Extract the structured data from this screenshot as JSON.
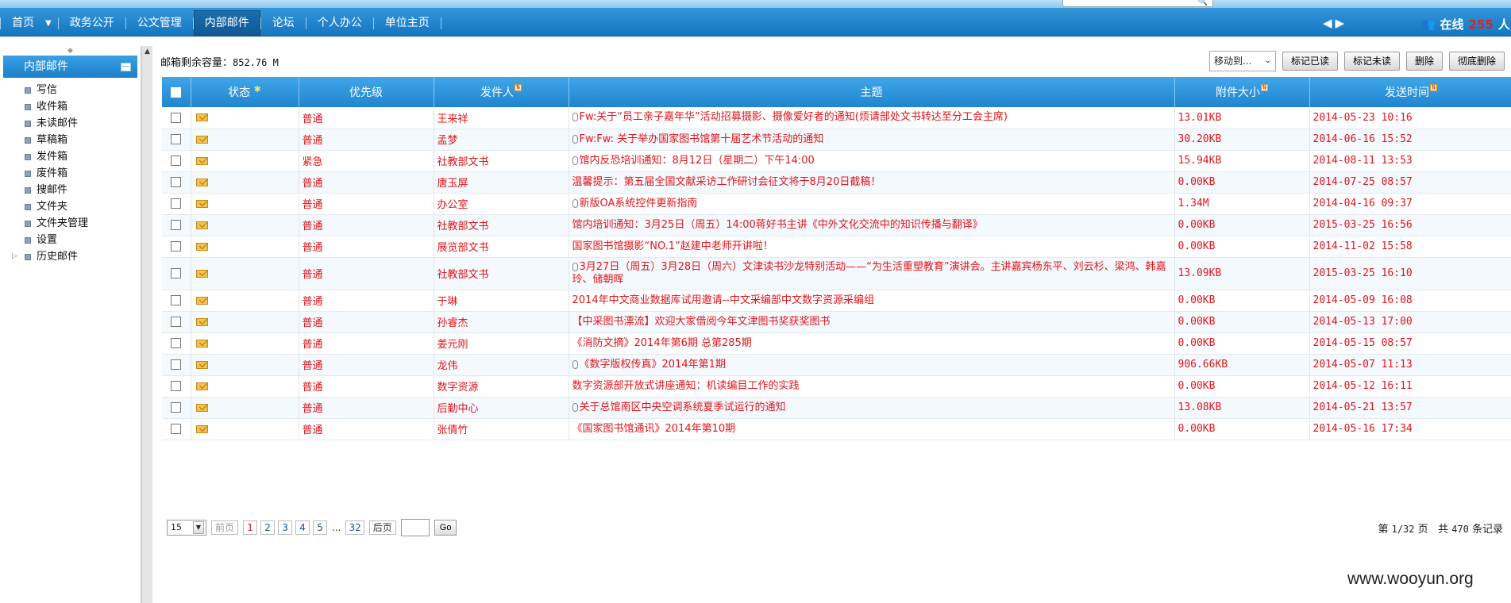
{
  "nav": {
    "items": [
      "首页",
      "政务公开",
      "公文管理",
      "内部邮件",
      "论坛",
      "个人办公",
      "单位主页"
    ],
    "active_index": 3,
    "search_icon": "magnifier-icon",
    "arrows_icon": "nav-arrows-icon"
  },
  "online": {
    "prefix": "在线",
    "count": "255",
    "suffix": "人"
  },
  "sidebar": {
    "title": "内部邮件",
    "items": [
      "写信",
      "收件箱",
      "未读邮件",
      "草稿箱",
      "发件箱",
      "废件箱",
      "搜邮件",
      "文件夹",
      "文件夹管理",
      "设置",
      "历史邮件"
    ]
  },
  "capacity": {
    "label": "邮箱剩余容量：",
    "value": "852.76 M"
  },
  "toolbar": {
    "move_select": "移动到...",
    "mark_read": "标记已读",
    "mark_unread": "标记未读",
    "delete": "删除",
    "purge": "彻底删除"
  },
  "table": {
    "headers": {
      "status": "状态",
      "priority": "优先级",
      "sender": "发件人",
      "subject": "主题",
      "size": "附件大小",
      "time": "发送时间"
    },
    "rows": [
      {
        "priority": "普通",
        "sender": "王来祥",
        "attach": true,
        "subject": "Fw:关于“员工亲子嘉年华”活动招募摄影、摄像爱好者的通知(烦请部处文书转达至分工会主席)",
        "size": "13.01KB",
        "time": "2014-05-23 10:16"
      },
      {
        "priority": "普通",
        "sender": "孟梦",
        "attach": true,
        "subject": "Fw:Fw: 关于举办国家图书馆第十届艺术节活动的通知",
        "size": "30.20KB",
        "time": "2014-06-16 15:52"
      },
      {
        "priority": "紧急",
        "sender": "社教部文书",
        "attach": true,
        "subject": "馆内反恐培训通知：8月12日（星期二）下午14:00",
        "size": "15.94KB",
        "time": "2014-08-11 13:53"
      },
      {
        "priority": "普通",
        "sender": "唐玉屏",
        "attach": false,
        "subject": "温馨提示：第五届全国文献采访工作研讨会征文将于8月20日截稿！",
        "size": "0.00KB",
        "time": "2014-07-25 08:57"
      },
      {
        "priority": "普通",
        "sender": "办公室",
        "attach": true,
        "subject": "新版OA系统控件更新指南",
        "size": "1.34M",
        "time": "2014-04-16 09:37"
      },
      {
        "priority": "普通",
        "sender": "社教部文书",
        "attach": false,
        "subject": "馆内培训通知：3月25日（周五）14:00蒋好书主讲《中外文化交流中的知识传播与翻译》",
        "size": "0.00KB",
        "time": "2015-03-25 16:56"
      },
      {
        "priority": "普通",
        "sender": "展览部文书",
        "attach": false,
        "subject": "国家图书馆摄影“NO.1”赵建中老师开讲啦！",
        "size": "0.00KB",
        "time": "2014-11-02 15:58"
      },
      {
        "priority": "普通",
        "sender": "社教部文书",
        "attach": true,
        "subject": "3月27日（周五）3月28日（周六）文津读书沙龙特别活动——“为生活重塑教育”演讲会。主讲嘉宾杨东平、刘云杉、梁鸿、韩嘉玲、储朝晖",
        "size": "13.09KB",
        "time": "2015-03-25 16:10"
      },
      {
        "priority": "普通",
        "sender": "于琳",
        "attach": false,
        "subject": "2014年中文商业数据库试用邀请--中文采编部中文数字资源采编组",
        "size": "0.00KB",
        "time": "2014-05-09 16:08"
      },
      {
        "priority": "普通",
        "sender": "孙睿杰",
        "attach": false,
        "subject": "【中采图书漂流】欢迎大家借阅今年文津图书奖获奖图书",
        "size": "0.00KB",
        "time": "2014-05-13 17:00"
      },
      {
        "priority": "普通",
        "sender": "姜元刚",
        "attach": false,
        "subject": "《消防文摘》2014年第6期 总第285期",
        "size": "0.00KB",
        "time": "2014-05-15 08:57"
      },
      {
        "priority": "普通",
        "sender": "龙伟",
        "attach": true,
        "subject": "《数字版权传真》2014年第1期",
        "size": "906.66KB",
        "time": "2014-05-07 11:13"
      },
      {
        "priority": "普通",
        "sender": "数字资源",
        "attach": false,
        "subject": "数字资源部开放式讲座通知：机读编目工作的实践",
        "size": "0.00KB",
        "time": "2014-05-12 16:11"
      },
      {
        "priority": "普通",
        "sender": "后勤中心",
        "attach": true,
        "subject": "关于总馆南区中央空调系统夏季试运行的通知",
        "size": "13.08KB",
        "time": "2014-05-21 13:57"
      },
      {
        "priority": "普通",
        "sender": "张倩竹",
        "attach": false,
        "subject": "《国家图书馆通讯》2014年第10期",
        "size": "0.00KB",
        "time": "2014-05-16 17:34"
      }
    ]
  },
  "pager": {
    "page_size": "15",
    "prev": "前页",
    "pages": [
      "1",
      "2",
      "3",
      "4",
      "5"
    ],
    "dots": "...",
    "last": "32",
    "next": "后页",
    "go": "Go",
    "info_pre": "第 ",
    "current": "1/32",
    "info_mid": " 页   共 ",
    "total": "470",
    "info_post": " 条记录"
  },
  "watermark": "www.wooyun.org",
  "colors": {
    "header_blue": "#1e85cf",
    "text_red": "#e0151b",
    "accent_dark": "#0f5793"
  }
}
